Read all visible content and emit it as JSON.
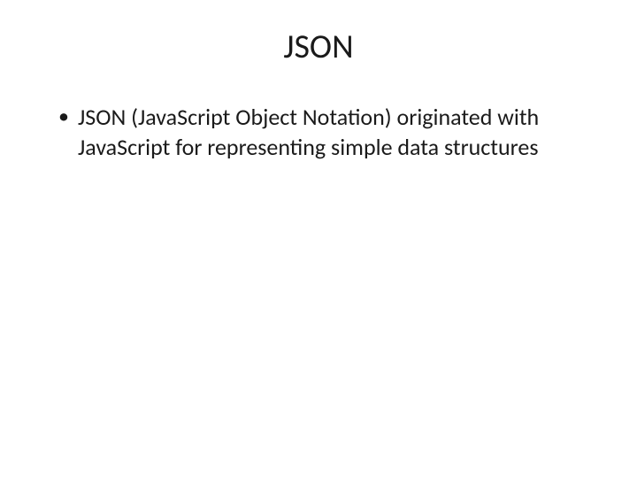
{
  "slide": {
    "title": "JSON",
    "bullets": [
      "JSON (JavaScript Object Notation) originated with JavaScript for representing simple data structures"
    ]
  }
}
